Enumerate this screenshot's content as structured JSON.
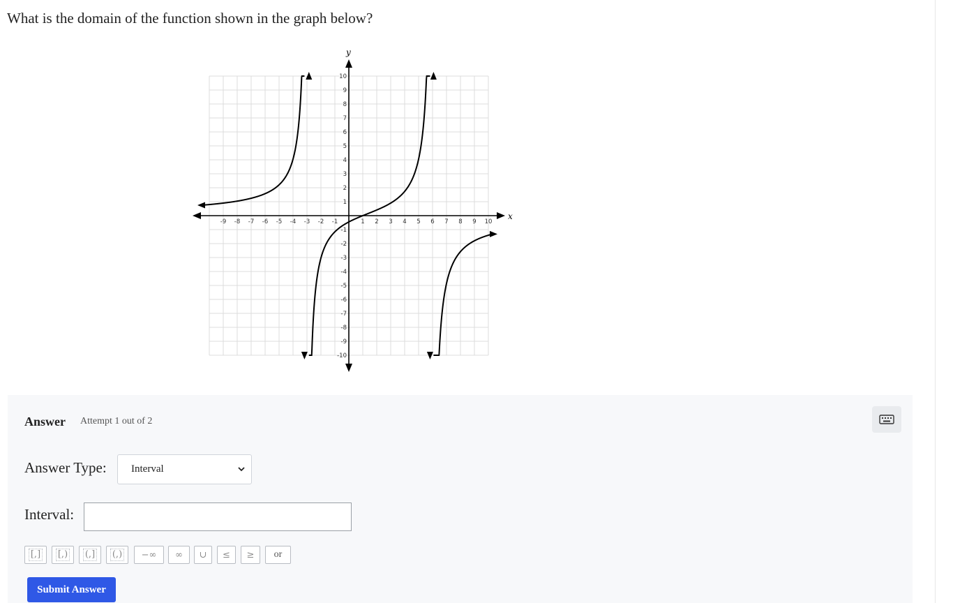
{
  "question": {
    "text": "What is the domain of the function shown in the graph below?"
  },
  "graph": {
    "x_axis_label": "x",
    "y_axis_label": "y",
    "x_range": [
      -10,
      10
    ],
    "y_range": [
      -10,
      10
    ],
    "x_tick_labels": [
      "-9",
      "-8",
      "-7",
      "-6",
      "-5",
      "-4",
      "-3",
      "-2",
      "-1",
      "1",
      "2",
      "3",
      "4",
      "5",
      "6",
      "7",
      "8",
      "9",
      "10"
    ],
    "y_tick_labels": [
      "10",
      "9",
      "8",
      "7",
      "6",
      "5",
      "4",
      "3",
      "2",
      "1",
      "-1",
      "-2",
      "-3",
      "-4",
      "-5",
      "-6",
      "-7",
      "-8",
      "-9",
      "-10"
    ],
    "grid": true,
    "vertical_asymptotes": [
      -3,
      6
    ],
    "curve_color": "#000000",
    "grid_color": "#dcdcdc"
  },
  "answer": {
    "heading": "Answer",
    "attempt": "Attempt 1 out of 2",
    "type_label": "Answer Type:",
    "type_selected": "Interval",
    "interval_label": "Interval:",
    "interval_value": "",
    "tools": [
      {
        "label": "[,]",
        "name": "closed-interval-button"
      },
      {
        "label": "[,)",
        "name": "half-open-right-button"
      },
      {
        "label": "(,]",
        "name": "half-open-left-button"
      },
      {
        "label": "(,)",
        "name": "open-interval-button"
      },
      {
        "label": "−∞",
        "name": "negative-infinity-button"
      },
      {
        "label": "∞",
        "name": "infinity-button"
      },
      {
        "label": "∪",
        "name": "union-button"
      },
      {
        "label": "≤",
        "name": "less-equal-button"
      },
      {
        "label": "≥",
        "name": "greater-equal-button"
      },
      {
        "label": "or",
        "name": "or-button"
      }
    ],
    "submit_label": "Submit Answer",
    "keyboard_icon": "keyboard-icon",
    "accent_color": "#2f58e6"
  }
}
